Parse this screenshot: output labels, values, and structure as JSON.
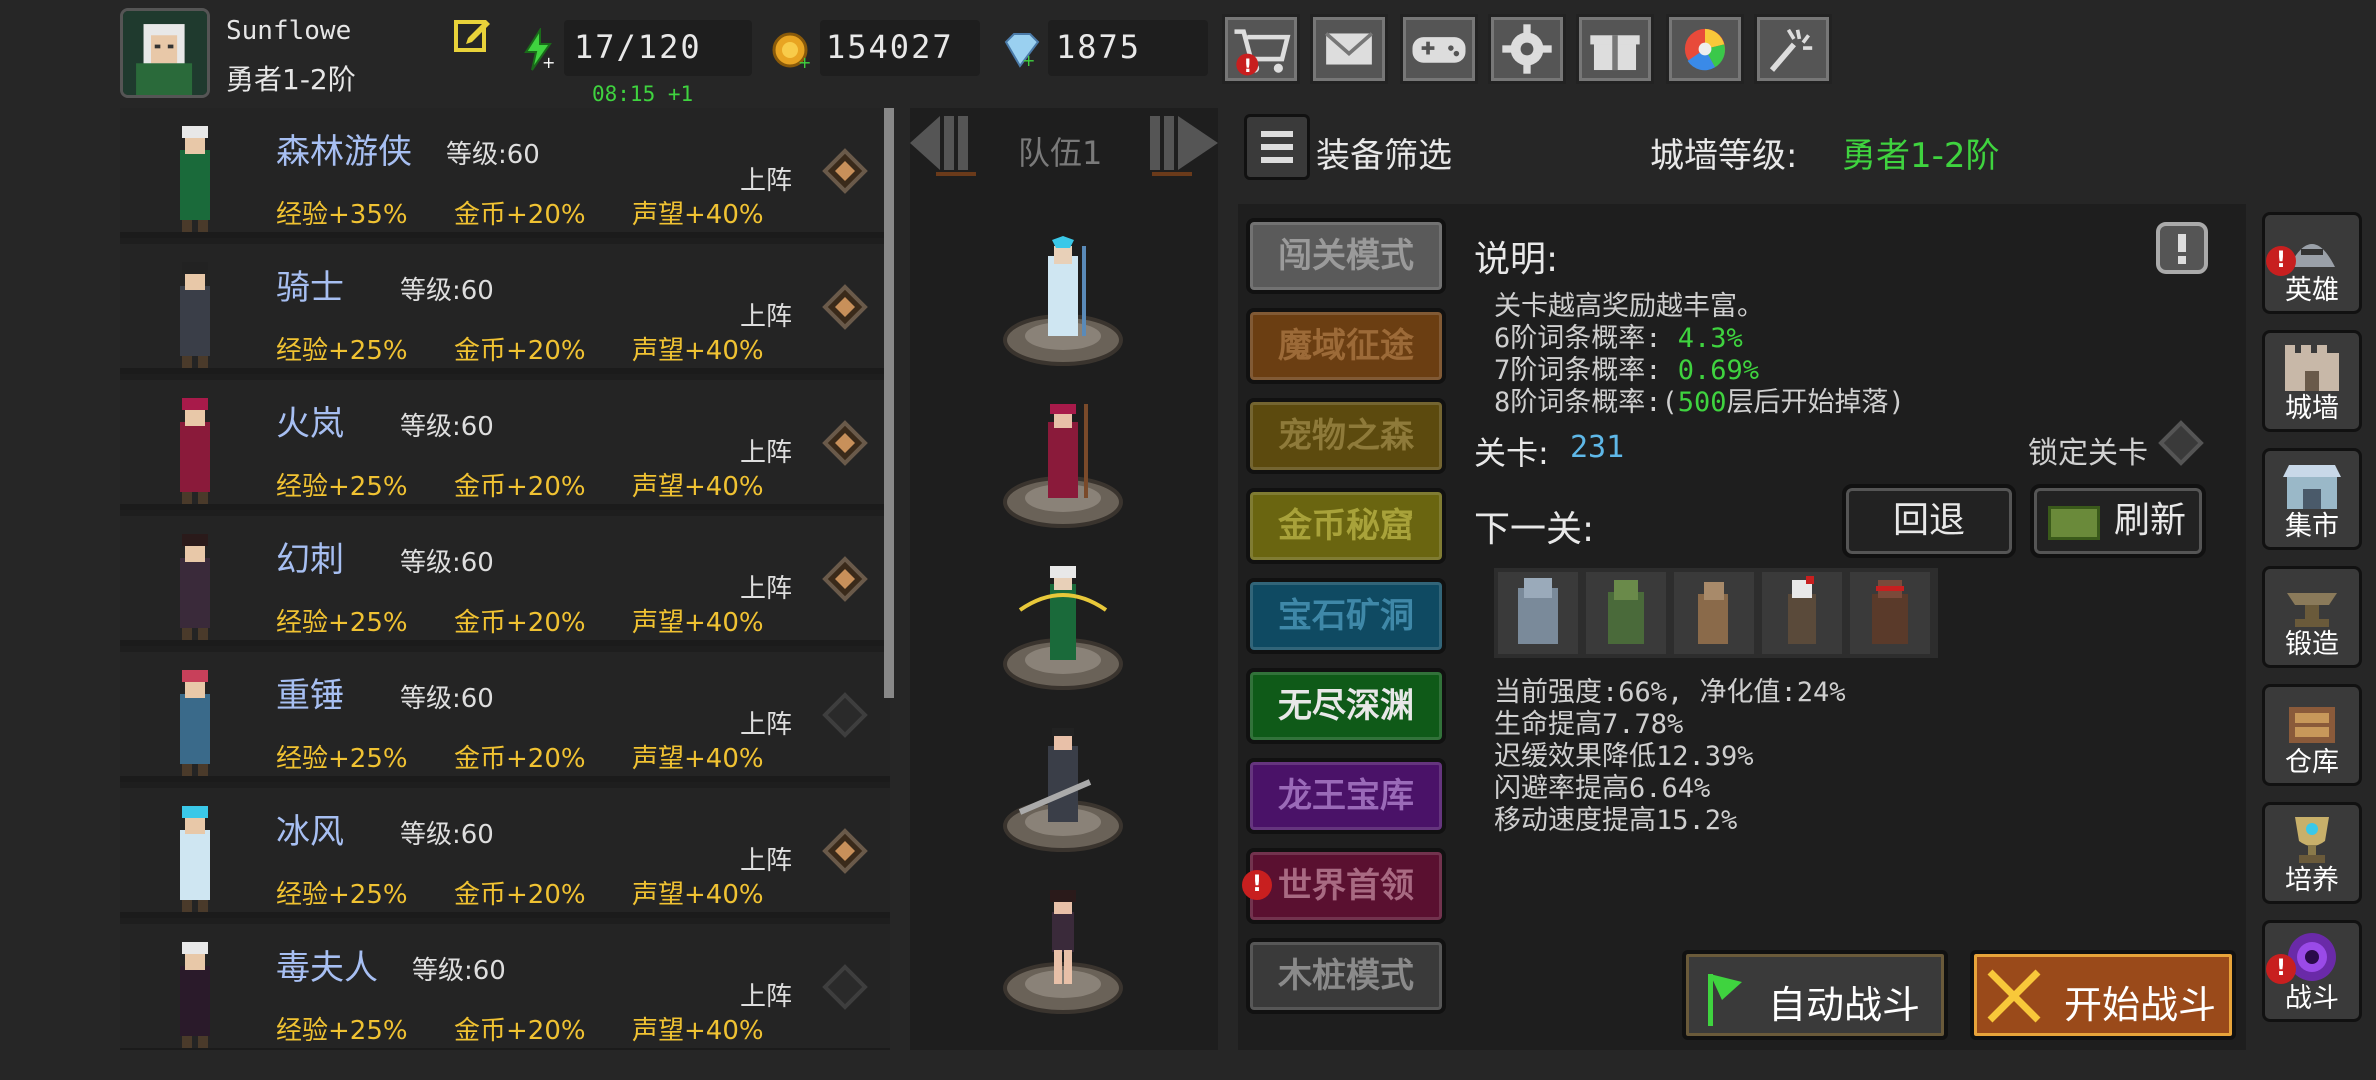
{
  "player": {
    "name": "Sunflowe",
    "rank": "勇者1-2阶"
  },
  "resources": {
    "energy": "17/120",
    "energy_timer": "08:15 +1",
    "gold": "154027",
    "gems": "1875"
  },
  "top_buttons": [
    "cart-icon",
    "mail-icon",
    "gamepad-icon",
    "gear-icon",
    "gift-icon",
    "color-wheel-icon",
    "firework-icon"
  ],
  "heroes": [
    {
      "name": "森林游侠",
      "level": "等级:60",
      "exp": "经验+35%",
      "gold": "金币+20%",
      "fame": "声望+40%",
      "deploy": "上阵",
      "active": true
    },
    {
      "name": "骑士",
      "level": "等级:60",
      "exp": "经验+25%",
      "gold": "金币+20%",
      "fame": "声望+40%",
      "deploy": "上阵",
      "active": true
    },
    {
      "name": "火岚",
      "level": "等级:60",
      "exp": "经验+25%",
      "gold": "金币+20%",
      "fame": "声望+40%",
      "deploy": "上阵",
      "active": true
    },
    {
      "name": "幻刺",
      "level": "等级:60",
      "exp": "经验+25%",
      "gold": "金币+20%",
      "fame": "声望+40%",
      "deploy": "上阵",
      "active": true
    },
    {
      "name": "重锤",
      "level": "等级:60",
      "exp": "经验+25%",
      "gold": "金币+20%",
      "fame": "声望+40%",
      "deploy": "上阵",
      "active": false
    },
    {
      "name": "冰风",
      "level": "等级:60",
      "exp": "经验+25%",
      "gold": "金币+20%",
      "fame": "声望+40%",
      "deploy": "上阵",
      "active": true
    },
    {
      "name": "毒夫人",
      "level": "等级:60",
      "exp": "经验+25%",
      "gold": "金币+20%",
      "fame": "声望+40%",
      "deploy": "上阵",
      "active": false
    }
  ],
  "team": {
    "title": "队伍1"
  },
  "filter": {
    "label": "装备筛选"
  },
  "wall": {
    "label": "城墙等级:",
    "value": "勇者1-2阶"
  },
  "modes": [
    {
      "label": "闯关模式",
      "color": "#5a5a5a",
      "text": "#9a9a9a"
    },
    {
      "label": "魔域征途",
      "color": "#6b3e12",
      "text": "#9c6a38"
    },
    {
      "label": "宠物之森",
      "color": "#5c4a0e",
      "text": "#8e7a3a"
    },
    {
      "label": "金币秘窟",
      "color": "#6a6510",
      "text": "#a8a23a"
    },
    {
      "label": "宝石矿洞",
      "color": "#0f4a62",
      "text": "#3f88a8"
    },
    {
      "label": "无尽深渊",
      "color": "#0f5a18",
      "text": "#e8e8e8"
    },
    {
      "label": "龙王宝库",
      "color": "#4a1268",
      "text": "#9a6ab8"
    },
    {
      "label": "世界首领",
      "color": "#5a1030",
      "text": "#a86a82"
    },
    {
      "label": "木桩模式",
      "color": "#3a3a3a",
      "text": "#8a8a8a"
    }
  ],
  "description": {
    "title": "说明:",
    "line1": "关卡越高奖励越丰富。",
    "line2_label": "6阶词条概率:",
    "line2_value": "4.3%",
    "line3_label": "7阶词条概率:",
    "line3_value": "0.69%",
    "line4_prefix": "8阶词条概率:(",
    "line4_value": "500",
    "line4_suffix": "层后开始掉落)"
  },
  "stage": {
    "label": "关卡:",
    "value": "231",
    "lock_label": "锁定关卡"
  },
  "next": {
    "label": "下一关:",
    "back": "回退",
    "refresh": "刷新"
  },
  "stage_stats": [
    "当前强度:66%, 净化值:24%",
    "生命提高7.78%",
    "迟缓效果降低12.39%",
    "闪避率提高6.64%",
    "移动速度提高15.2%"
  ],
  "actions": {
    "auto": "自动战斗",
    "start": "开始战斗"
  },
  "sidebar": [
    "英雄",
    "城墙",
    "集市",
    "锻造",
    "仓库",
    "培养",
    "战斗"
  ]
}
